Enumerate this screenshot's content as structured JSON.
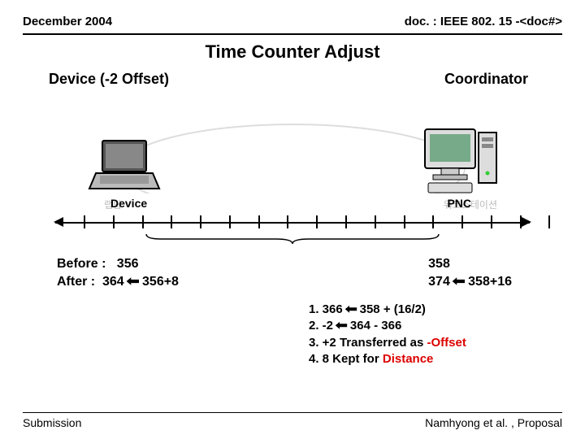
{
  "header": {
    "date": "December 2004",
    "docref": "doc. : IEEE 802. 15 -<doc#>"
  },
  "title": "Time Counter Adjust",
  "roles": {
    "left": "Device (-2 Offset)",
    "right": "Coordinator"
  },
  "axis": {
    "left_label": "Device",
    "right_label": "PNC",
    "ghost_left": "랩탑",
    "ghost_right": "워크스테이션"
  },
  "values": {
    "left": {
      "before_label": "Before :",
      "before_val": "356",
      "after_label": "After :",
      "after_val": "364",
      "after_expr": "356+8"
    },
    "right": {
      "line1": "358",
      "line2_val": "374",
      "line2_expr": "358+16"
    }
  },
  "notes": {
    "l1_pre": "1. 366 ",
    "l1_post": " 358 + (16/2)",
    "l2_pre": "2. -2 ",
    "l2_post": " 364 - 366",
    "l3_pre": "3. +2 Transferred as ",
    "l3_red": "-Offset",
    "l4_pre": "4.  8 Kept for ",
    "l4_red": "Distance"
  },
  "footer": {
    "left": "Submission",
    "right": "Namhyong et al. , Proposal"
  },
  "glyph": {
    "leftarrow": "⬅"
  }
}
